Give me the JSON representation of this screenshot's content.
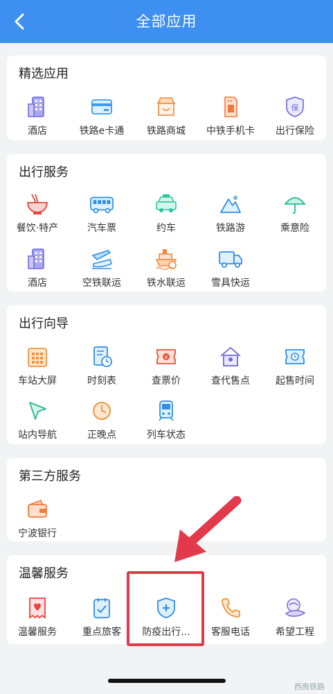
{
  "header": {
    "title": "全部应用"
  },
  "sections": [
    {
      "title": "精选应用",
      "items": [
        {
          "label": "酒店",
          "icon": "hotel-building-icon"
        },
        {
          "label": "铁路e卡通",
          "icon": "card-icon"
        },
        {
          "label": "铁路商城",
          "icon": "shop-icon"
        },
        {
          "label": "中铁手机卡",
          "icon": "sim-card-icon"
        },
        {
          "label": "出行保险",
          "icon": "insurance-shield-icon"
        }
      ]
    },
    {
      "title": "出行服务",
      "items": [
        {
          "label": "餐饮·特产",
          "icon": "noodle-bowl-icon"
        },
        {
          "label": "汽车票",
          "icon": "bus-icon"
        },
        {
          "label": "约车",
          "icon": "taxi-icon"
        },
        {
          "label": "铁路游",
          "icon": "mountain-icon"
        },
        {
          "label": "乘意险",
          "icon": "umbrella-icon"
        },
        {
          "label": "酒店",
          "icon": "hotel-building-icon"
        },
        {
          "label": "空铁联运",
          "icon": "plane-train-icon"
        },
        {
          "label": "铁水联运",
          "icon": "ship-icon"
        },
        {
          "label": "雪具快运",
          "icon": "truck-icon"
        }
      ]
    },
    {
      "title": "出行向导",
      "items": [
        {
          "label": "车站大屏",
          "icon": "calendar-board-icon"
        },
        {
          "label": "时刻表",
          "icon": "timetable-icon"
        },
        {
          "label": "查票价",
          "icon": "ticket-price-icon"
        },
        {
          "label": "查代售点",
          "icon": "house-icon"
        },
        {
          "label": "起售时间",
          "icon": "ticket-clock-icon"
        },
        {
          "label": "站内导航",
          "icon": "navigation-arrow-icon"
        },
        {
          "label": "正晚点",
          "icon": "clock-icon"
        },
        {
          "label": "列车状态",
          "icon": "train-icon"
        }
      ]
    },
    {
      "title": "第三方服务",
      "items": [
        {
          "label": "宁波银行",
          "icon": "wallet-icon"
        }
      ]
    },
    {
      "title": "温馨服务",
      "items": [
        {
          "label": "温馨服务",
          "icon": "heart-ticket-icon"
        },
        {
          "label": "重点旅客",
          "icon": "checklist-icon"
        },
        {
          "label": "防疫出行...",
          "icon": "medical-shield-icon"
        },
        {
          "label": "客服电话",
          "icon": "phone-icon"
        },
        {
          "label": "希望工程",
          "icon": "hope-logo-icon"
        }
      ]
    }
  ],
  "watermark": "西南铁路",
  "colors": {
    "header": "#3d8ff0",
    "highlight": "#e23a4b",
    "arrow": "#e23a4b"
  }
}
